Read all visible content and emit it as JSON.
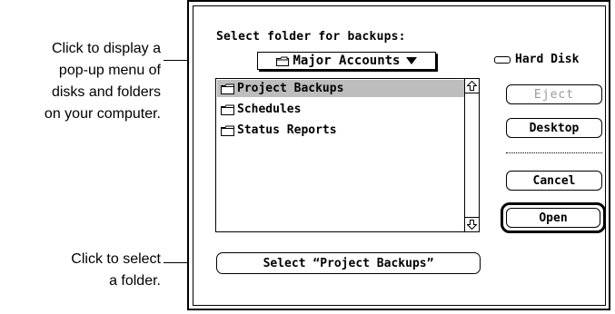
{
  "callouts": {
    "popup_menu": [
      "Click to display a",
      "pop-up menu of",
      "disks and folders",
      "on your computer."
    ],
    "select_folder": [
      "Click to select",
      "a folder."
    ]
  },
  "dialog": {
    "prompt": "Select folder for backups:",
    "popup": {
      "label": "Major Accounts",
      "icon": "folder-icon"
    },
    "disk": {
      "name": "Hard Disk",
      "icon": "hard-disk-icon"
    },
    "list": {
      "items": [
        {
          "label": "Project Backups",
          "icon": "folder-icon",
          "selected": true
        },
        {
          "label": "Schedules",
          "icon": "folder-icon",
          "selected": false
        },
        {
          "label": "Status Reports",
          "icon": "folder-icon",
          "selected": false
        }
      ]
    },
    "buttons": {
      "eject": "Eject",
      "desktop": "Desktop",
      "cancel": "Cancel",
      "open": "Open",
      "select": "Select “Project Backups”"
    }
  }
}
